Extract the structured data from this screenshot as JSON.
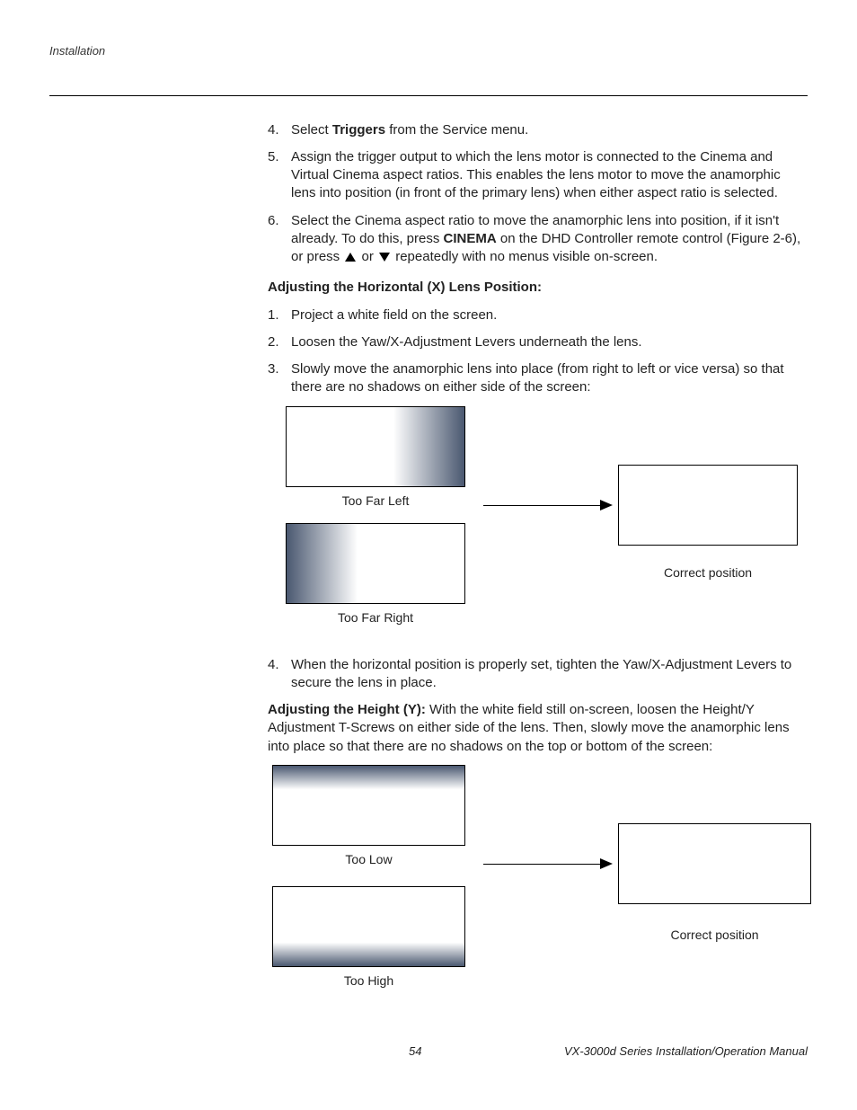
{
  "header": {
    "section": "Installation"
  },
  "list1": [
    {
      "num": "4.",
      "pre": "Select ",
      "bold": "Triggers",
      "post": " from the Service menu."
    },
    {
      "num": "5.",
      "text": "Assign the trigger output to which the lens motor is connected to the Cinema and Virtual Cinema aspect ratios. This enables the lens motor to move the anamorphic lens into position (in front of the primary lens) when either aspect ratio is selected."
    },
    {
      "num": "6.",
      "preA": "Select the Cinema aspect ratio to move the anamorphic lens into position, if it isn't already. To do this, press ",
      "boldA": "CINEMA",
      "midA": " on the DHD Controller remote control (Figure 2-6), or press ",
      "postA": " repeatedly with no menus visible on-screen."
    }
  ],
  "subheading1": "Adjusting the Horizontal (X) Lens Position:",
  "list2": [
    {
      "num": "1.",
      "text": "Project a white field on the screen."
    },
    {
      "num": "2.",
      "text": "Loosen the Yaw/X-Adjustment Levers underneath the lens."
    },
    {
      "num": "3.",
      "text": "Slowly move the anamorphic lens into place (from right to left or vice versa) so that there are no shadows on either side of the screen:"
    }
  ],
  "diagram1": {
    "label_top": "Too Far Left",
    "label_bottom": "Too Far Right",
    "label_right": "Correct position"
  },
  "list3": [
    {
      "num": "4.",
      "text": "When the horizontal position is properly set, tighten the Yaw/X-Adjustment Levers to secure the lens in place."
    }
  ],
  "para2": {
    "bold": "Adjusting the Height (Y): ",
    "text": "With the white field still on-screen, loosen the Height/Y Adjustment T-Screws on either side of the lens. Then, slowly move the anamorphic lens into place so that there are no shadows on the top or bottom of the screen:"
  },
  "diagram2": {
    "label_top": "Too Low",
    "label_bottom": "Too High",
    "label_right": "Correct position"
  },
  "footer": {
    "page": "54",
    "doc": "VX-3000d Series Installation/Operation Manual"
  }
}
